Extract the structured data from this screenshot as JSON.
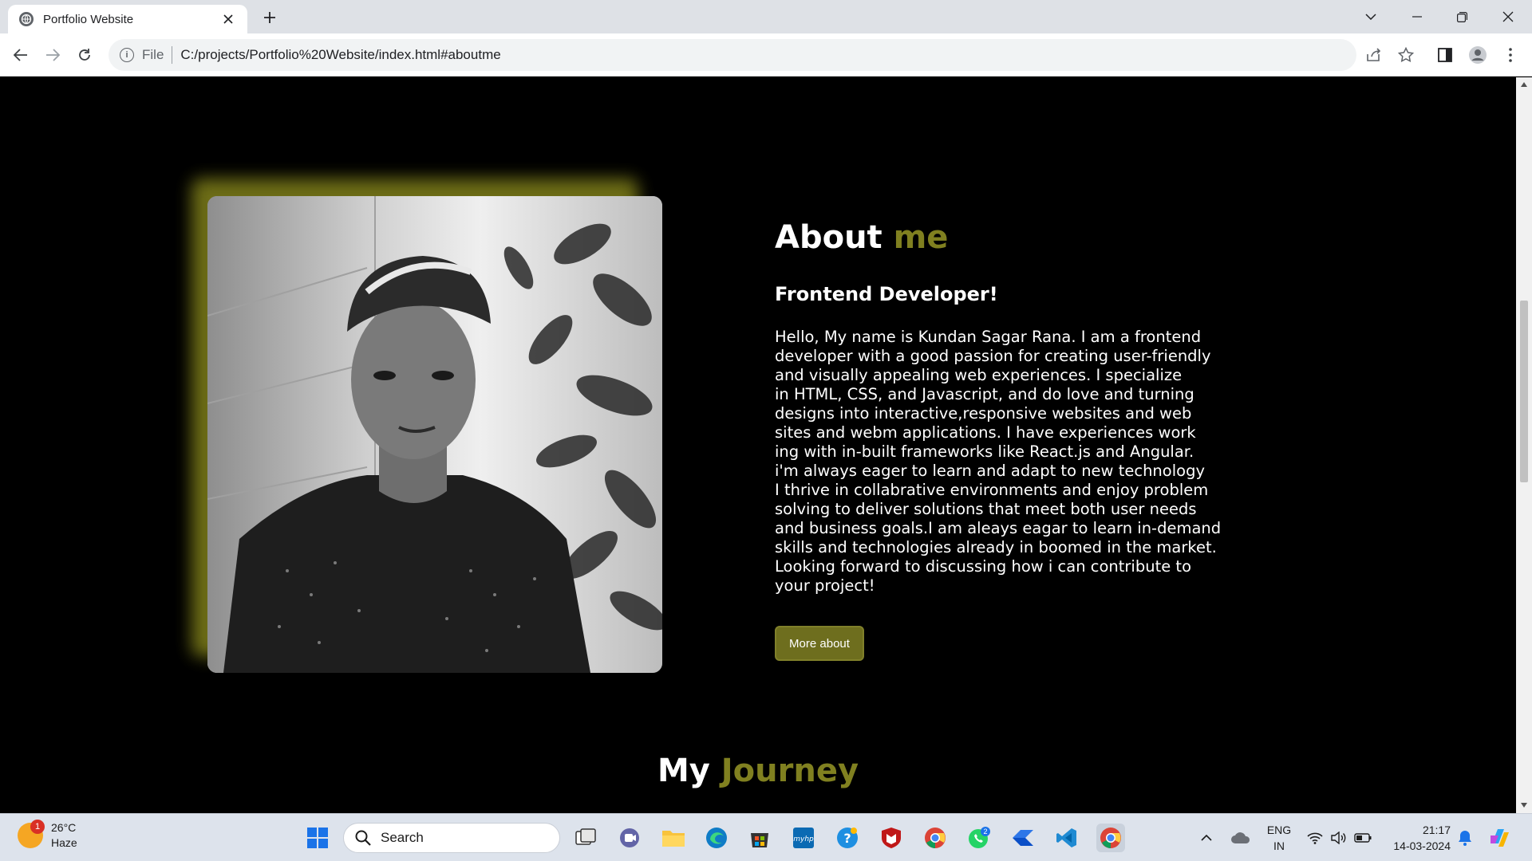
{
  "browser": {
    "tab_title": "Portfolio Website",
    "url_scheme": "File",
    "url": "C:/projects/Portfolio%20Website/index.html#aboutme"
  },
  "about": {
    "title_main": "About",
    "title_accent": "me",
    "role": "Frontend Developer!",
    "bio": "Hello, My name is Kundan Sagar Rana. I am a frontend\ndeveloper with a good passion for creating user-friendly\nand visually appealing web experiences. I specialize\nin HTML, CSS, and Javascript, and do love and turning\ndesigns into interactive,responsive websites and web\nsites and webm applications. I have experiences work\ning with in-built frameworks like React.js and Angular.\ni'm always eager to learn and adapt to new technology\nI thrive in collabrative environments and enjoy problem\nsolving to deliver solutions that meet both user needs\nand business goals.I am aleays eagar to learn in-demand\nskills and technologies already in boomed in the market.\nLooking forward to discussing how i can contribute to\nyour project!",
    "button_label": "More about"
  },
  "journey": {
    "title_main": "My",
    "title_accent": "Journey"
  },
  "colors": {
    "accent": "#808020",
    "page_bg": "#000000",
    "button_bg": "#6e6e1e"
  },
  "taskbar": {
    "weather_temp": "26°C",
    "weather_desc": "Haze",
    "weather_badge": "1",
    "search_label": "Search",
    "whatsapp_badge": "2",
    "lang_line1": "ENG",
    "lang_line2": "IN",
    "time": "21:17",
    "date": "14-03-2024"
  }
}
